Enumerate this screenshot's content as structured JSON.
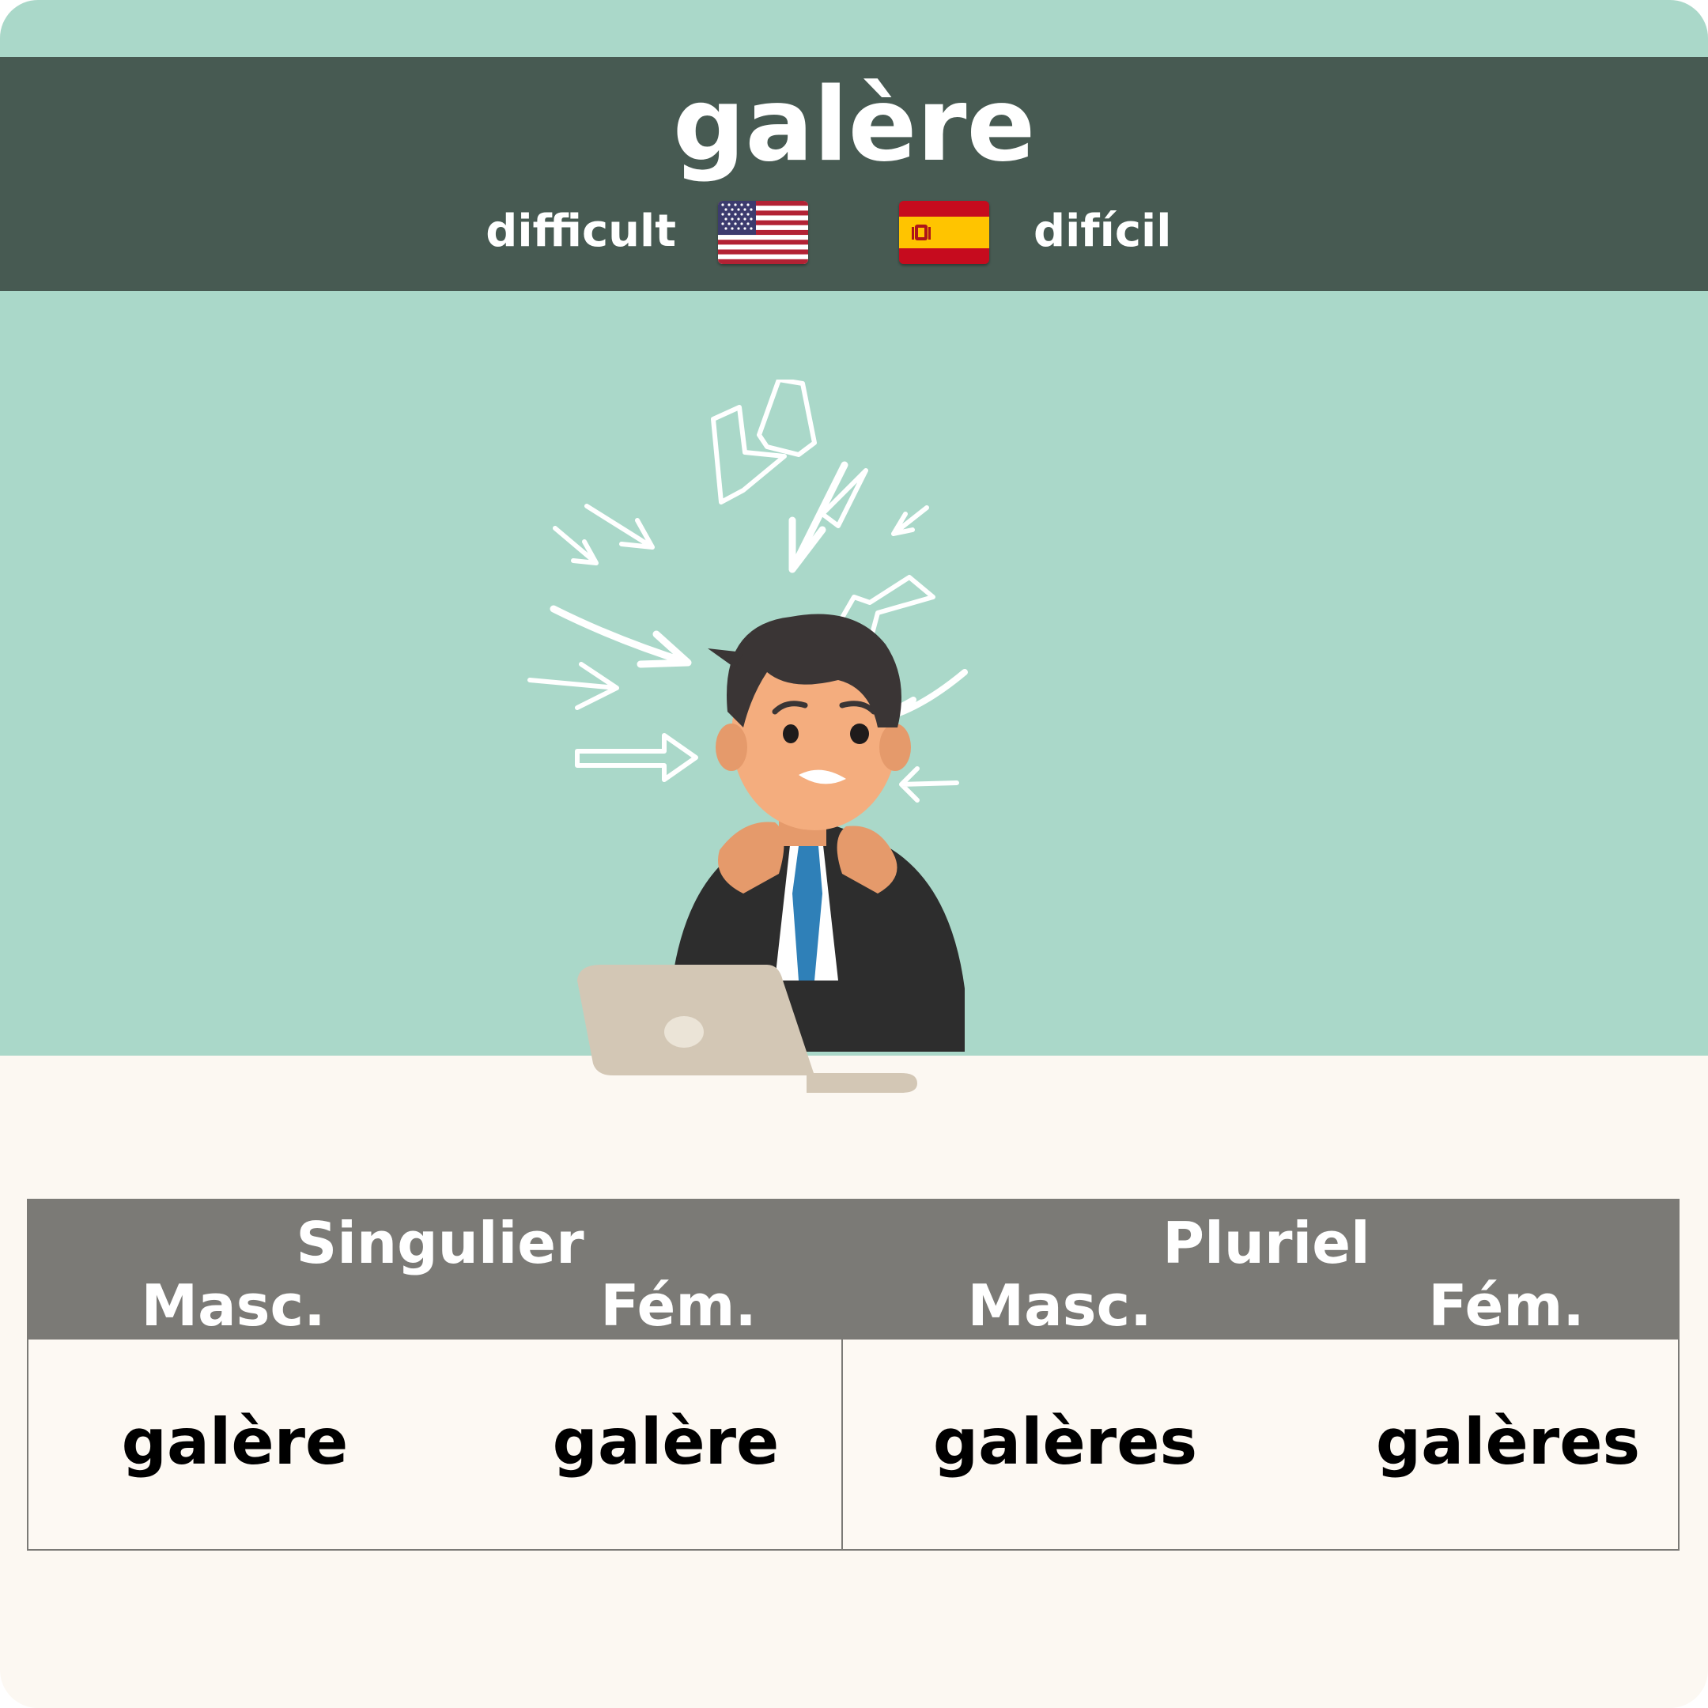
{
  "word": "galère",
  "translations": {
    "en": "difficult",
    "es": "difícil"
  },
  "flags": {
    "en": "us-flag-icon",
    "es": "spain-flag-icon"
  },
  "colors": {
    "header": "#475a52",
    "background_top": "#aad8c9",
    "background_bottom": "#fcf8f2",
    "table_header": "#7b7a76"
  },
  "table": {
    "groups": [
      "Singulier",
      "Pluriel"
    ],
    "subheaders": [
      "Masc.",
      "Fém.",
      "Masc.",
      "Fém."
    ],
    "values": [
      "galère",
      "galère",
      "galères",
      "galères"
    ]
  }
}
